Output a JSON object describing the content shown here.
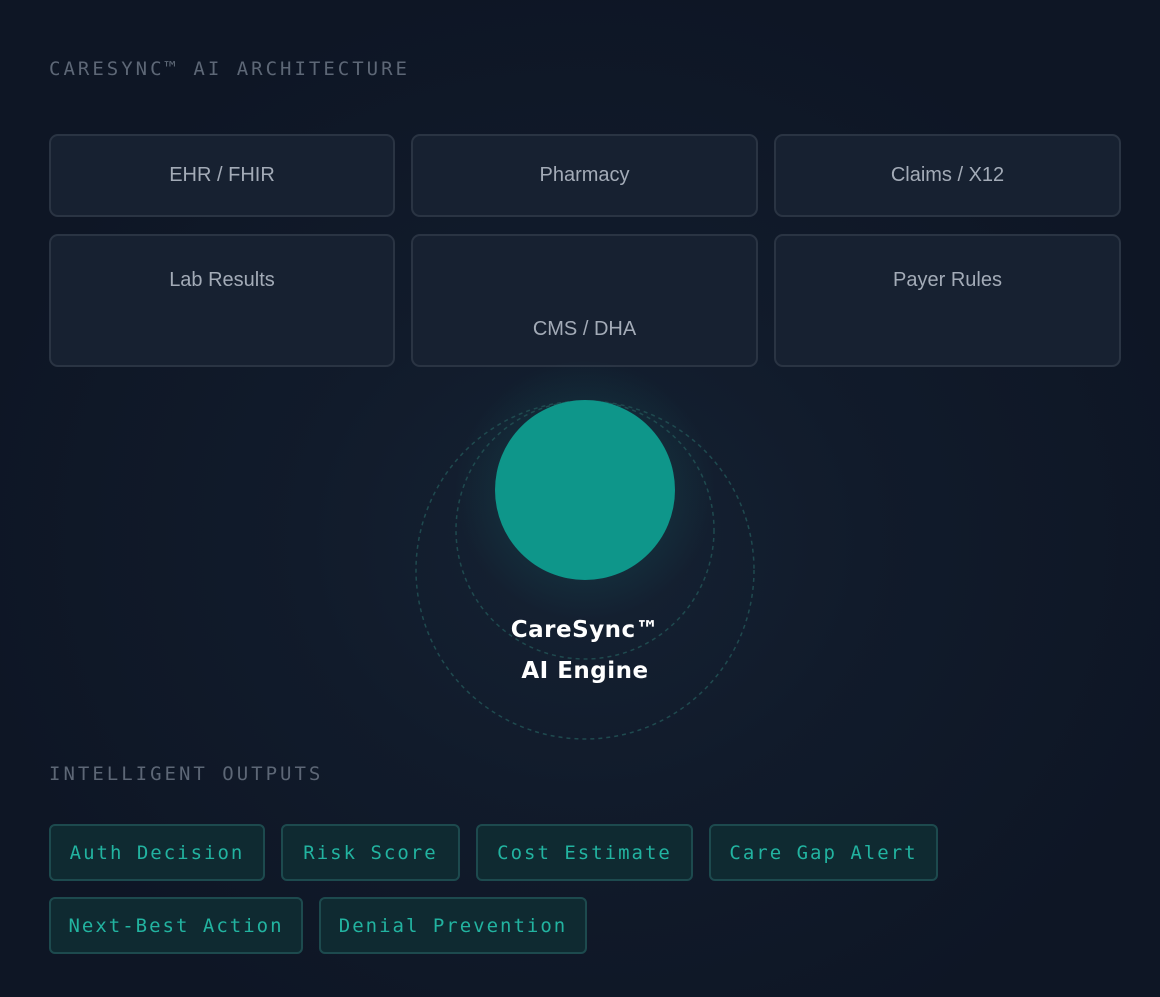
{
  "header": {
    "title": "CARESYNC™ AI ARCHITECTURE"
  },
  "sources": [
    {
      "label": "EHR / FHIR"
    },
    {
      "label": "Pharmacy"
    },
    {
      "label": "Claims / X12"
    },
    {
      "label": "Lab Results"
    },
    {
      "label": "CMS / DHA"
    },
    {
      "label": "Payer Rules"
    }
  ],
  "engine": {
    "line1": "CareSync™",
    "line2": "AI Engine",
    "color": "#0e968a"
  },
  "outputs": {
    "title": "INTELLIGENT OUTPUTS",
    "items": [
      {
        "label": "Auth Decision"
      },
      {
        "label": "Risk Score"
      },
      {
        "label": "Cost Estimate"
      },
      {
        "label": "Care Gap Alert"
      },
      {
        "label": "Next-Best Action"
      },
      {
        "label": "Denial Prevention"
      }
    ]
  },
  "colors": {
    "background": "#0e1625",
    "card": "#172131",
    "card_border": "#2a3443",
    "accent": "#22b3a0",
    "chip_bg": "#0f2a31"
  }
}
